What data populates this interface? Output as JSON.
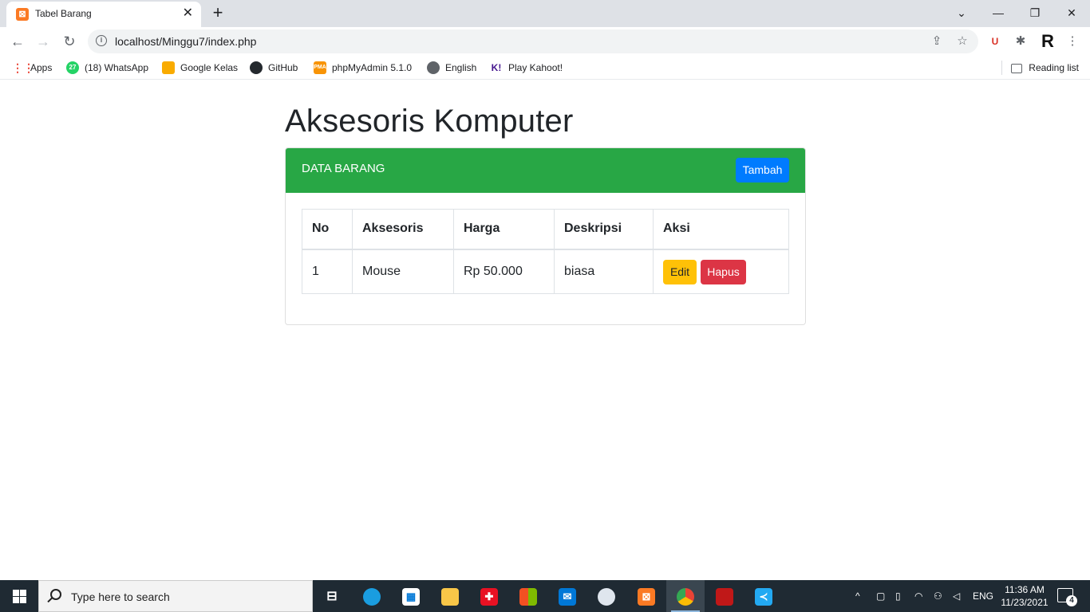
{
  "browser": {
    "tab": {
      "title": "Tabel Barang",
      "favicon": "xampp-icon",
      "close_glyph": "✕"
    },
    "new_tab_glyph": "+",
    "window_controls": {
      "tabsearch": "⌄",
      "minimize": "—",
      "restore": "❐",
      "close": "✕"
    },
    "nav": {
      "back": "←",
      "forward": "→",
      "reload": "↻"
    },
    "address": {
      "url": "localhost/Minggu7/index.php",
      "info_glyph": "i"
    },
    "omnibox_icons": {
      "share": "⇪",
      "bookmark": "☆"
    },
    "toolbar_icons": {
      "extension1": "U",
      "extensions": "✱",
      "profile": "R",
      "menu": "⋮"
    },
    "bookmarks": [
      {
        "label": "Apps",
        "icon": "apps-grid-icon",
        "color": "#ea4335"
      },
      {
        "label": "(18) WhatsApp",
        "icon": "whatsapp-icon",
        "color": "#25d366",
        "badge": "27"
      },
      {
        "label": "Google Kelas",
        "icon": "google-classroom-icon",
        "color": "#f9ab00"
      },
      {
        "label": "GitHub",
        "icon": "github-icon",
        "color": "#24292e"
      },
      {
        "label": "phpMyAdmin 5.1.0",
        "icon": "phpmyadmin-icon",
        "color": "#f89406"
      },
      {
        "label": "English",
        "icon": "globe-icon",
        "color": "#5f6368"
      },
      {
        "label": "Play Kahoot!",
        "icon": "kahoot-icon",
        "color": "#46178f"
      }
    ],
    "reading_list": "Reading list"
  },
  "page": {
    "heading": "Aksesoris Komputer",
    "card": {
      "header_title": "DATA BARANG",
      "add_button": "Tambah",
      "colors": {
        "header_bg": "#28a745",
        "primary": "#007bff",
        "warning": "#ffc107",
        "danger": "#dc3545"
      }
    },
    "table": {
      "headers": [
        "No",
        "Aksesoris",
        "Harga",
        "Deskripsi",
        "Aksi"
      ],
      "rows": [
        {
          "no": "1",
          "aksesoris": "Mouse",
          "harga": "Rp 50.000",
          "deskripsi": "biasa",
          "edit": "Edit",
          "hapus": "Hapus"
        }
      ]
    }
  },
  "taskbar": {
    "search_placeholder": "Type here to search",
    "apps": [
      "task-view",
      "edge",
      "store",
      "file-explorer",
      "gift",
      "office",
      "mail",
      "paint",
      "xampp",
      "chrome",
      "mcafee",
      "vscode"
    ],
    "tray": {
      "chevron": "^",
      "language": "ENG"
    },
    "clock": {
      "time": "11:36 AM",
      "date": "11/23/2021"
    },
    "notifications": "4"
  }
}
